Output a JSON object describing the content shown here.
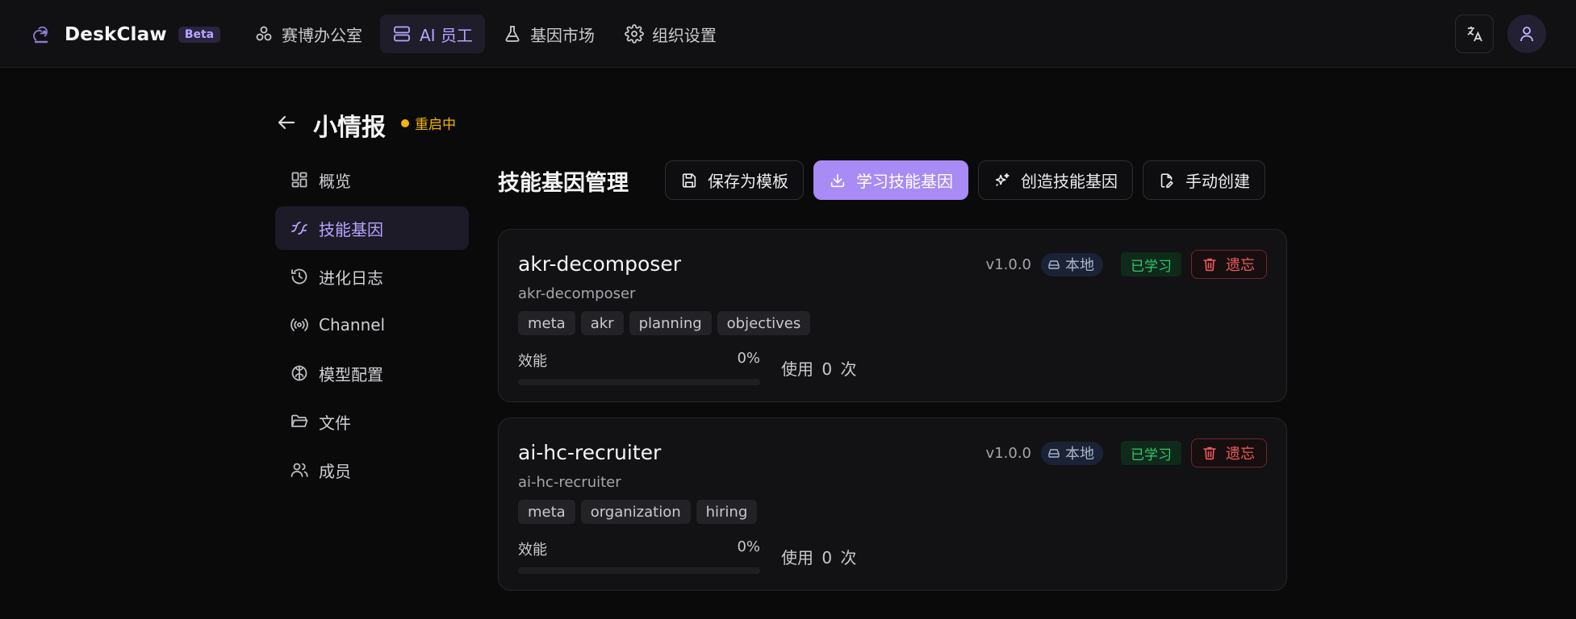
{
  "app": {
    "name": "DeskClaw",
    "badge": "Beta"
  },
  "nav": [
    {
      "label": "赛博办公室",
      "icon": "molecule-icon",
      "active": false
    },
    {
      "label": "AI 员工",
      "icon": "server-icon",
      "active": true
    },
    {
      "label": "基因市场",
      "icon": "flask-icon",
      "active": false
    },
    {
      "label": "组织设置",
      "icon": "gear-icon",
      "active": false
    }
  ],
  "header": {
    "title": "小情报",
    "status": "重启中",
    "status_color": "#f5b400"
  },
  "sidebar": [
    {
      "label": "概览",
      "icon": "dashboard-icon"
    },
    {
      "label": "技能基因",
      "icon": "sparkle-icon",
      "active": true
    },
    {
      "label": "进化日志",
      "icon": "history-icon"
    },
    {
      "label": "Channel",
      "icon": "radio-icon"
    },
    {
      "label": "模型配置",
      "icon": "brain-icon"
    },
    {
      "label": "文件",
      "icon": "folder-icon"
    },
    {
      "label": "成员",
      "icon": "users-icon"
    }
  ],
  "section": {
    "title": "技能基因管理",
    "actions": [
      {
        "label": "保存为模板",
        "icon": "save-icon"
      },
      {
        "label": "学习技能基因",
        "icon": "download-icon",
        "primary": true
      },
      {
        "label": "创造技能基因",
        "icon": "sparkles-icon"
      },
      {
        "label": "手动创建",
        "icon": "file-edit-icon"
      }
    ]
  },
  "skills": [
    {
      "name": "akr-decomposer",
      "slug": "akr-decomposer",
      "tags": [
        "meta",
        "akr",
        "planning",
        "objectives"
      ],
      "perf_label": "效能",
      "perf_value": "0%",
      "perf_fraction": 0,
      "usage_prefix": "使用",
      "usage_count": "0",
      "usage_suffix": "次",
      "version": "v1.0.0",
      "source": "本地",
      "status": "已学习",
      "forget_label": "遗忘"
    },
    {
      "name": "ai-hc-recruiter",
      "slug": "ai-hc-recruiter",
      "tags": [
        "meta",
        "organization",
        "hiring"
      ],
      "perf_label": "效能",
      "perf_value": "0%",
      "perf_fraction": 0,
      "usage_prefix": "使用",
      "usage_count": "0",
      "usage_suffix": "次",
      "version": "v1.0.0",
      "source": "本地",
      "status": "已学习",
      "forget_label": "遗忘"
    }
  ],
  "colors": {
    "accent": "#a88bf5",
    "success": "#34c76c",
    "danger": "#f05a5a",
    "background": "#0a0a0a"
  }
}
